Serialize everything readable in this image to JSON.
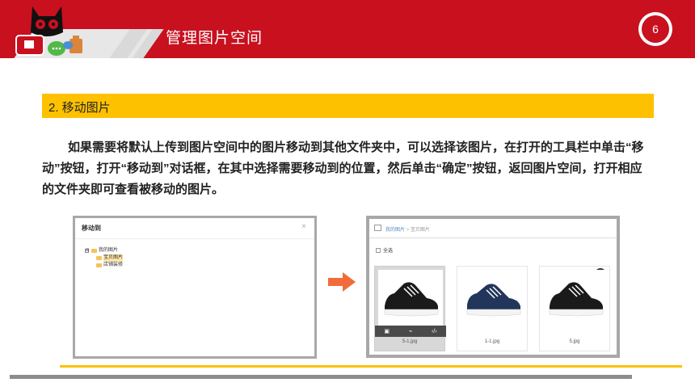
{
  "header": {
    "title": "管理图片空间",
    "page_number": "6"
  },
  "section": {
    "heading": "2. 移动图片"
  },
  "body": {
    "paragraph": "如果需要将默认上传到图片空间中的图片移动到其他文件夹中，可以选择该图片，在打开的工具栏中单击“移动”按钮，打开“移动到”对话框，在其中选择需要移动到的位置，然后单击“确定”按钮，返回图片空间，打开相应的文件夹即可查看被移动的图片。"
  },
  "dialog": {
    "title": "移动到",
    "close": "×",
    "tree": {
      "root": "我的图片",
      "expand_sign": "⊟",
      "children": [
        "宝贝图片",
        "店铺装修"
      ]
    }
  },
  "gallery": {
    "breadcrumb_root": "我的图片",
    "breadcrumb_sep": ">",
    "breadcrumb_current": "宝贝图片",
    "select_all": "全选",
    "items": [
      {
        "filename": "5-1.jpg"
      },
      {
        "filename": "1-1.jpg"
      },
      {
        "filename": "5.jpg"
      }
    ],
    "tag_label": "引"
  },
  "colors": {
    "brand_red": "#c8101e",
    "accent_yellow": "#fdc100",
    "frame_gray": "#a8a8a8",
    "arrow_orange": "#f26b3a"
  }
}
